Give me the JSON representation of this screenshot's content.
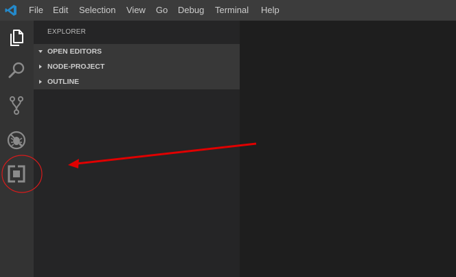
{
  "menu": {
    "items": [
      "File",
      "Edit",
      "Selection",
      "View",
      "Go",
      "Debug",
      "Terminal",
      "Help"
    ]
  },
  "activity_bar": {
    "icons": [
      "explorer-icon",
      "search-icon",
      "source-control-icon",
      "debug-icon",
      "extensions-icon"
    ]
  },
  "sidebar": {
    "title": "EXPLORER",
    "sections": [
      {
        "label": "OPEN EDITORS",
        "expanded": true
      },
      {
        "label": "NODE-PROJECT",
        "expanded": false
      },
      {
        "label": "OUTLINE",
        "expanded": false
      }
    ]
  },
  "colors": {
    "titlebar": "#3c3c3c",
    "activity_bar": "#333333",
    "sidebar": "#252526",
    "section_header": "#383838",
    "editor": "#1e1e1e",
    "annotation": "#e00000",
    "vscode_blue": "#2489ca"
  }
}
